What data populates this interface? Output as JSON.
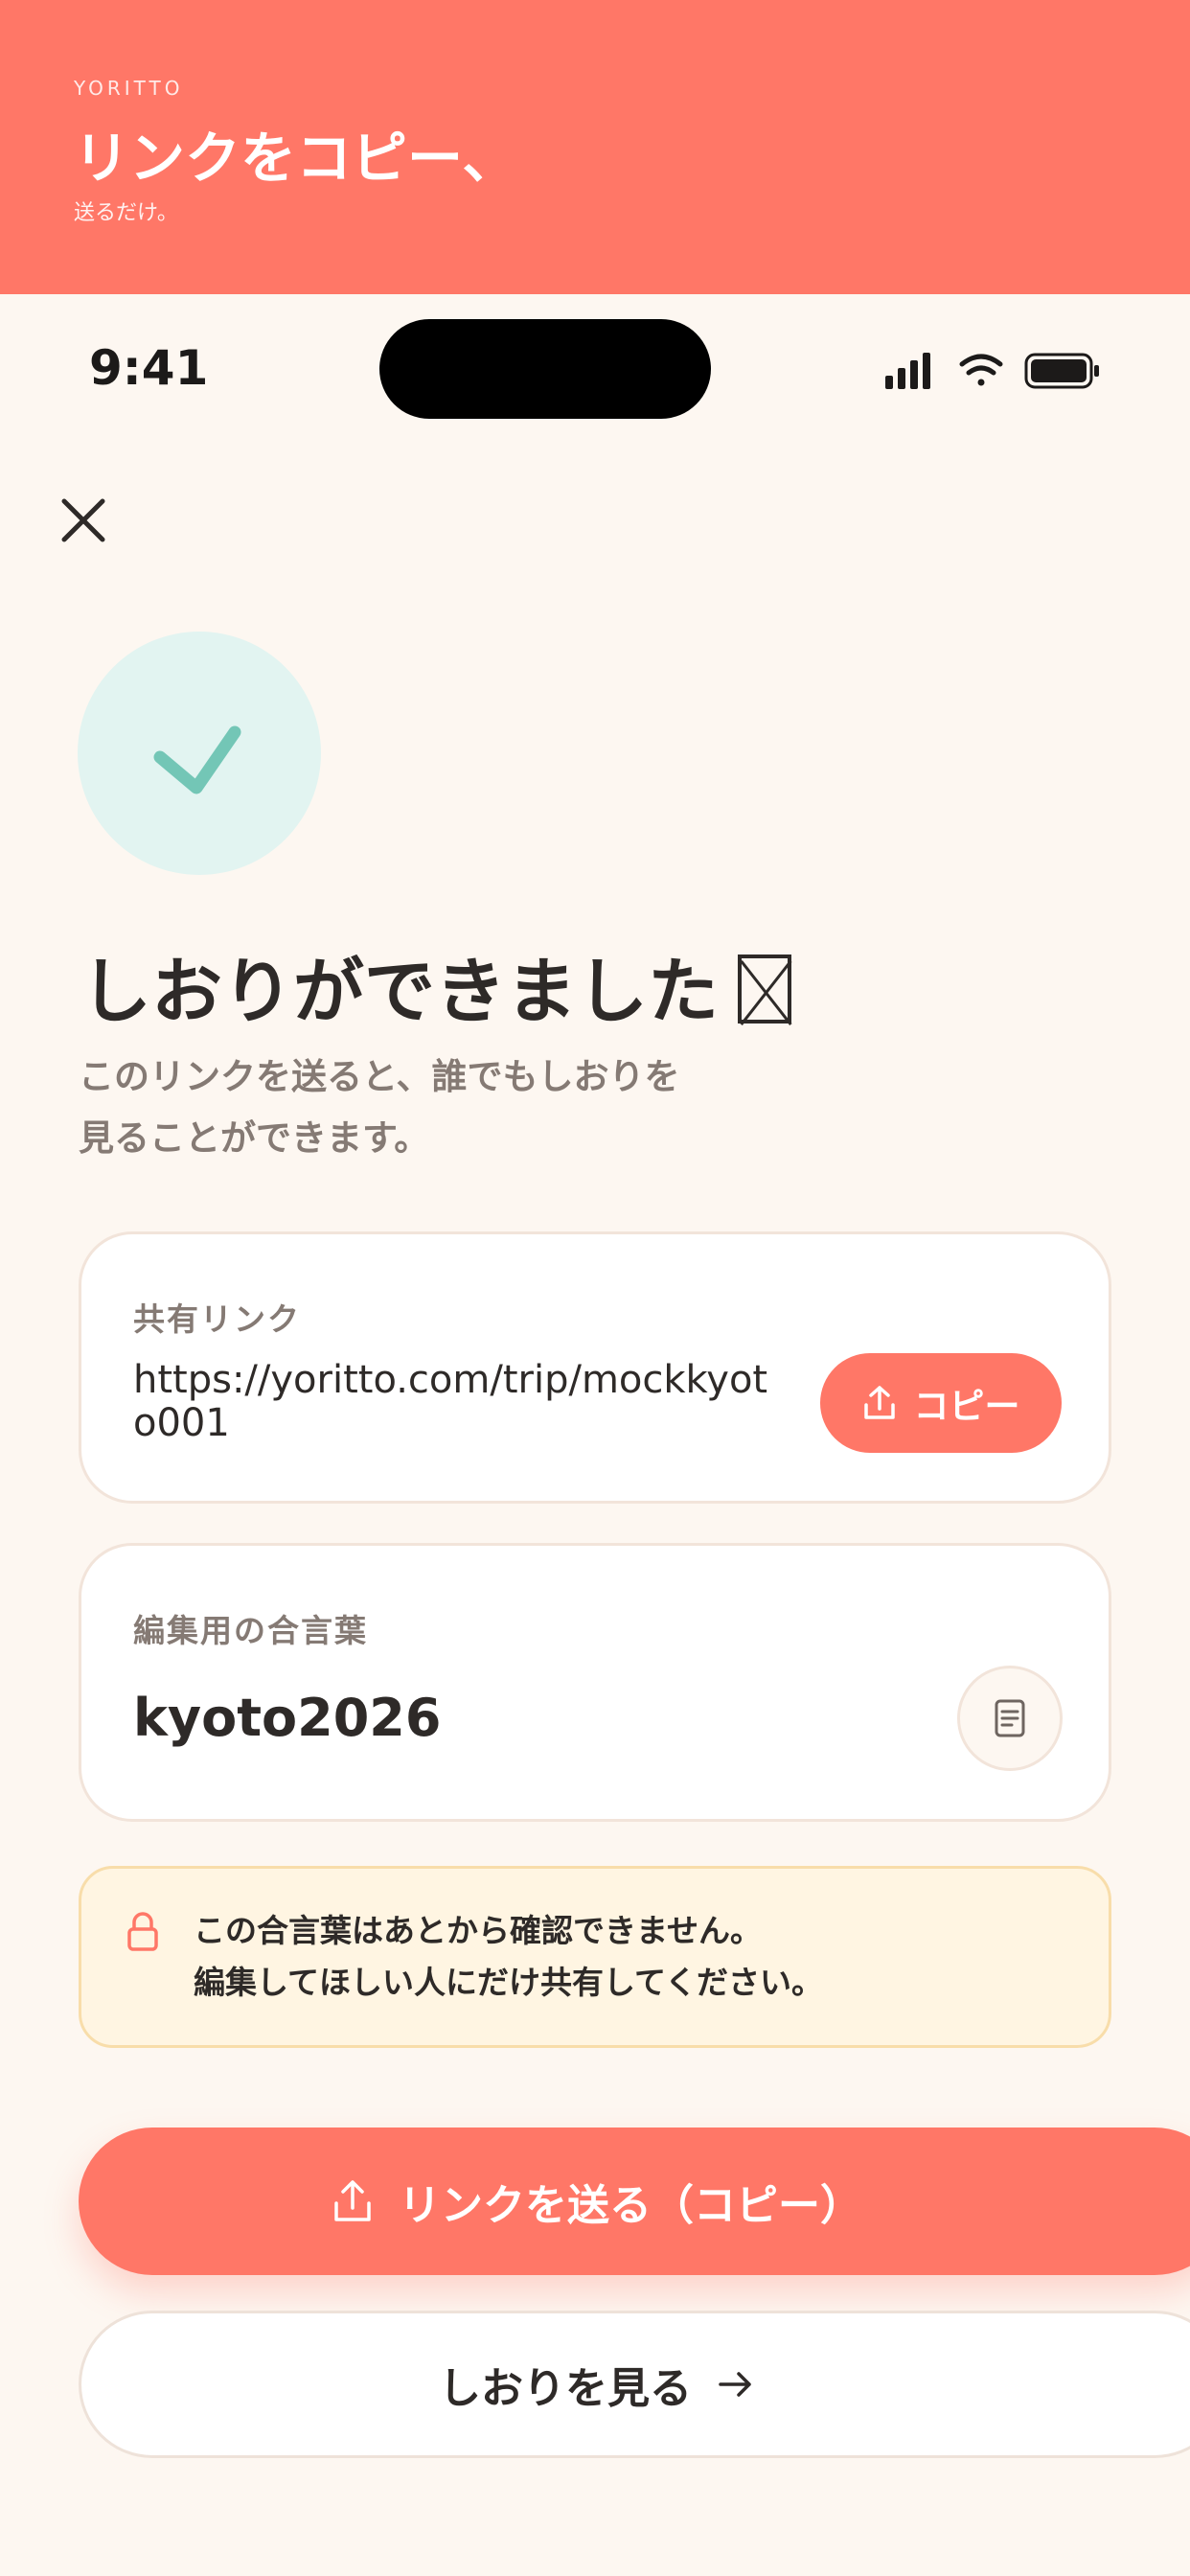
{
  "banner": {
    "brand": "YORITTO",
    "title": "リンクをコピー、",
    "subtitle": "送るだけ。"
  },
  "status_bar": {
    "time": "9:41"
  },
  "header": {
    "close_icon": "close-icon"
  },
  "success": {
    "icon": "checkmark-icon",
    "title": "しおりができました",
    "subtitle_line1": "このリンクを送ると、誰でもしおりを",
    "subtitle_line2": "見ることができます。"
  },
  "share_link_card": {
    "label": "共有リンク",
    "url": "https://yoritto.com/trip/mockkyoto001",
    "copy_label": "コピー"
  },
  "password_card": {
    "label": "編集用の合言葉",
    "value": "kyoto2026",
    "copy_icon": "document-copy-icon"
  },
  "notice": {
    "icon": "lock-icon",
    "line1": "この合言葉はあとから確認できません。",
    "line2": "編集してほしい人にだけ共有してください。"
  },
  "actions": {
    "primary_label": "リンクを送る（コピー）",
    "secondary_label": "しおりを見る"
  },
  "colors": {
    "accent": "#FF7767",
    "background": "#FDF7F1",
    "success_bg": "#E2F4F1",
    "success_check": "#73C6B6",
    "notice_bg": "#FFF5E2"
  }
}
